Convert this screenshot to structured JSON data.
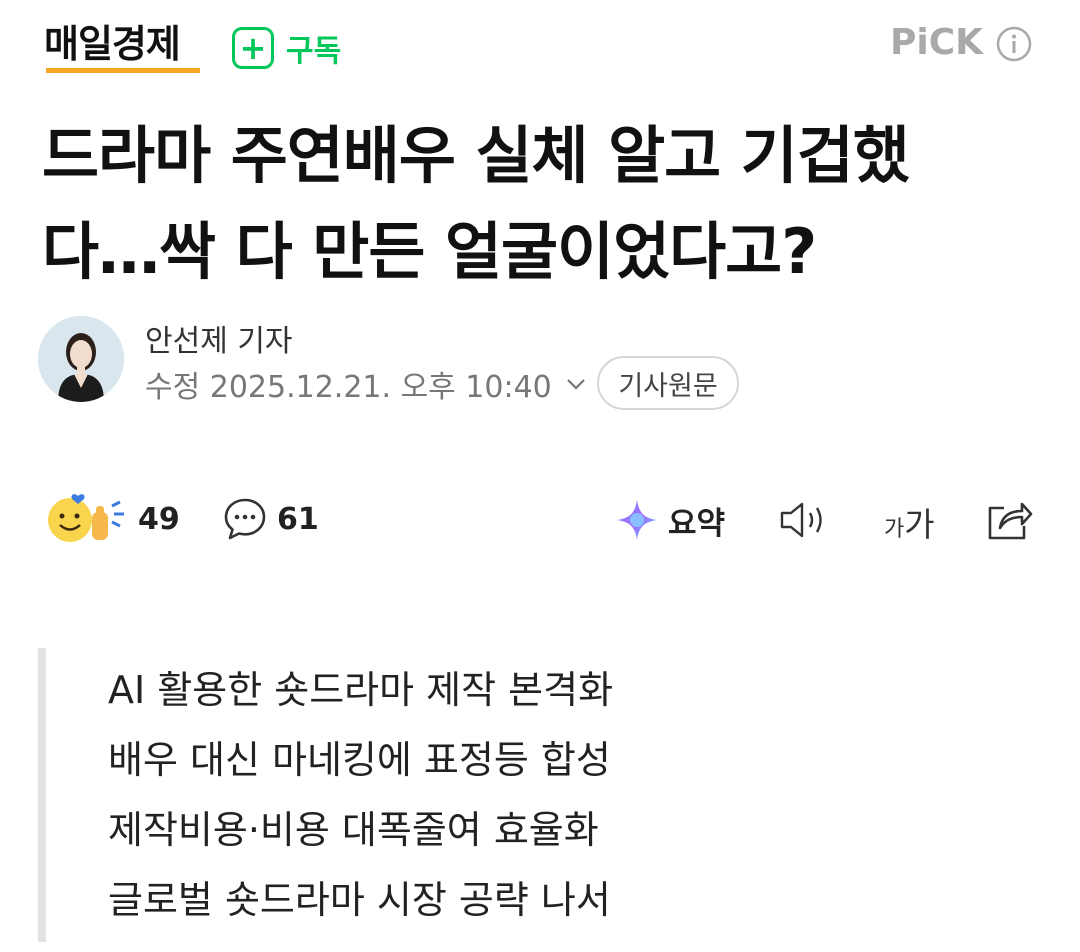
{
  "press": {
    "name": "매일경제",
    "subscribe_icon": "+",
    "subscribe_label": "구독",
    "pick_label": "PiCK",
    "colors": {
      "underline": "#f5a623",
      "subscribe": "#03c75a",
      "pick": "#a9a9a9"
    }
  },
  "article": {
    "headline_line1": "드라마 주연배우 실체 알고 기겁했",
    "headline_line2": "다…싹 다 만든 얼굴이었다고?",
    "reporter": "안선제 기자",
    "date": "수정 2025.12.21. 오후 10:40",
    "source_button": "기사원문"
  },
  "toolbar": {
    "reactions_count": "49",
    "comments_count": "61",
    "summary_label": "요약",
    "font_small": "가",
    "font_big": "가"
  },
  "summary_lines": [
    "AI 활용한 숏드라마 제작 본격화",
    "배우 대신 마네킹에 표정등 합성",
    "제작비용·비용 대폭줄여 효율화",
    "글로벌 숏드라마 시장 공략 나서"
  ],
  "icons": [
    "plus-icon",
    "info-icon",
    "chevron-down-icon",
    "reaction-emoji-icon",
    "comment-icon",
    "ai-summary-icon",
    "speaker-icon",
    "share-icon"
  ]
}
